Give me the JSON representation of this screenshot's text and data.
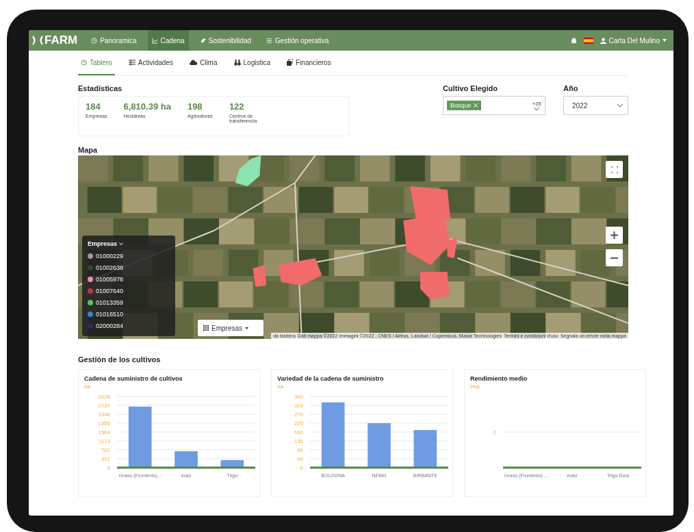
{
  "nav": {
    "logo": "FARM",
    "items": [
      {
        "label": "Panoramica",
        "selected": false
      },
      {
        "label": "Cadena",
        "selected": true
      },
      {
        "label": "Sostenibilidad",
        "selected": false
      },
      {
        "label": "Gestión operativa",
        "selected": false
      }
    ],
    "user": "Carta Del Mulino"
  },
  "subtabs": [
    {
      "label": "Tablero",
      "selected": true
    },
    {
      "label": "Actividades",
      "selected": false
    },
    {
      "label": "Clima",
      "selected": false
    },
    {
      "label": "Logistica",
      "selected": false
    },
    {
      "label": "Financieros",
      "selected": false
    }
  ],
  "stats": {
    "title": "Estadísticas",
    "items": [
      {
        "value": "184",
        "label": "Empresas"
      },
      {
        "value": "6,810.39 ha",
        "label": "Hectáreas"
      },
      {
        "value": "198",
        "label": "Agricultores"
      },
      {
        "value": "122",
        "label": "Centros de transferencia"
      }
    ]
  },
  "crop_filter": {
    "label": "Cultivo Elegido",
    "tags": [
      "Bosque"
    ],
    "more": "+35"
  },
  "year": {
    "label": "Año",
    "value": "2022"
  },
  "map": {
    "title": "Mapa",
    "legend": {
      "title": "Empresas",
      "items": [
        {
          "label": "01000229",
          "color": "#b58aa5"
        },
        {
          "label": "01002638",
          "color": "#2f4a2a"
        },
        {
          "label": "01005978",
          "color": "#f08ab0"
        },
        {
          "label": "01007640",
          "color": "#c0334d"
        },
        {
          "label": "01013359",
          "color": "#5cc46a"
        },
        {
          "label": "01016510",
          "color": "#3d7fd0"
        },
        {
          "label": "02000284",
          "color": "#2b2a6b"
        }
      ]
    },
    "layer_button": "Empresas",
    "attribution": [
      "da tastiera",
      "Dati mappa ©2022 Immagini ©2022 , CNES / Airbus, Landsat / Copernicus, Maxar Technologies",
      "Termini e condizioni d'uso",
      "Segnala un errore nella mappa"
    ]
  },
  "crops": {
    "title": "Gestión de los cultivos",
    "charts": [
      {
        "kind": "chart",
        "chart_data": {
          "type": "bar",
          "grid": true,
          "title": "Cadena de suministro de cultivos",
          "ylabel": "ha",
          "categories": [
            "Grano (Frumento)...",
            "maiz",
            "Trigo"
          ],
          "values": [
            2680,
            720,
            330
          ],
          "ylim": [
            0,
            3126
          ],
          "yticks": [
            0,
            391,
            782,
            1173,
            1564,
            1955,
            2346,
            2737,
            3126
          ]
        }
      },
      {
        "kind": "chart",
        "chart_data": {
          "type": "bar",
          "grid": true,
          "title": "Variedad de la cadena de suministro",
          "ylabel": "ha",
          "categories": [
            "BOLOGNA",
            "NEMO",
            "BIRBANTE"
          ],
          "values": [
            330,
            225,
            190
          ],
          "ylim": [
            0,
            360
          ],
          "yticks": [
            0,
            45,
            90,
            135,
            180,
            225,
            270,
            315,
            360
          ]
        }
      },
      {
        "kind": "empty",
        "title": "Rendimiento medio",
        "unit": "t/ha",
        "tick": "0",
        "categories": [
          "Grano (Frumento) ...",
          "maiz",
          "Trigo Duro"
        ]
      }
    ]
  }
}
